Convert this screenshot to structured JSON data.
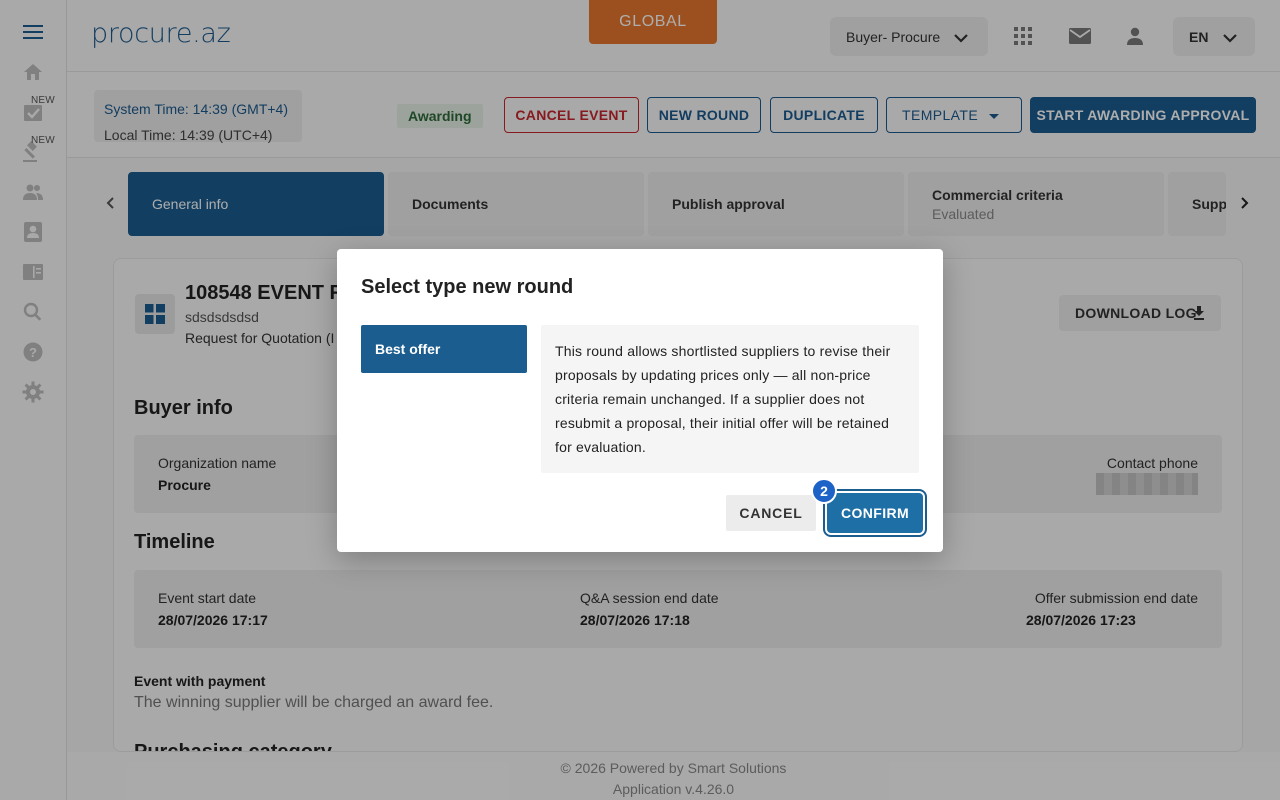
{
  "sidebar": {
    "items": [
      {
        "icon": "menu-icon"
      },
      {
        "icon": "home-icon"
      },
      {
        "icon": "task-check-icon",
        "badge": "NEW"
      },
      {
        "icon": "gavel-icon",
        "badge": "NEW"
      },
      {
        "icon": "people-icon"
      },
      {
        "icon": "contact-card-icon"
      },
      {
        "icon": "book-icon"
      },
      {
        "icon": "search-icon"
      },
      {
        "icon": "help-icon"
      },
      {
        "icon": "gear-icon"
      }
    ]
  },
  "header": {
    "logo": "procure.az",
    "global_label": "GLOBAL",
    "role": "Buyer- Procure",
    "language": "EN",
    "icons": [
      "apps-grid-icon",
      "mail-icon",
      "person-icon"
    ]
  },
  "toolbar": {
    "system_time": "System Time: 14:39 (GMT+4)",
    "local_time": "Local Time: 14:39 (UTC+4)",
    "status": "Awarding",
    "cancel_event": "CANCEL EVENT",
    "new_round": "NEW ROUND",
    "duplicate": "DUPLICATE",
    "template": "TEMPLATE",
    "start_approval": "START AWARDING APPROVAL"
  },
  "tabs": [
    {
      "label": "General info",
      "active": true
    },
    {
      "label": "Documents"
    },
    {
      "label": "Publish approval"
    },
    {
      "label": "Commercial criteria",
      "sub": "Evaluated"
    },
    {
      "label": "Suppl"
    }
  ],
  "event": {
    "title": "108548 EVENT F",
    "subtitle": "sdsdsdsdsd",
    "type": "Request for Quotation (I",
    "download_log": "DOWNLOAD LOG"
  },
  "buyer_info": {
    "heading": "Buyer info",
    "org_label": "Organization name",
    "org_value": "Procure",
    "phone_label": "Contact phone"
  },
  "timeline": {
    "heading": "Timeline",
    "items": [
      {
        "label": "Event start date",
        "value": "28/07/2026 17:17"
      },
      {
        "label": "Q&A session end date",
        "value": "28/07/2026 17:18"
      },
      {
        "label": "Offer submission end date",
        "value": "28/07/2026 17:23"
      }
    ]
  },
  "payment": {
    "title": "Event with payment",
    "text": "The winning supplier will be charged an award fee."
  },
  "category_heading": "Purchasing category",
  "footer": {
    "copyright": "© 2026 Powered by Smart Solutions",
    "version": "Application v.4.26.0"
  },
  "dialog": {
    "title": "Select type new round",
    "option": "Best offer",
    "description": "This round allows shortlisted suppliers to revise their proposals by updating prices only — all non-price criteria remain unchanged. If a supplier does not resubmit a proposal, their initial offer will be retained for evaluation.",
    "cancel": "CANCEL",
    "confirm": "CONFIRM",
    "step_badge": "2"
  },
  "colors": {
    "brand": "#1b5d8f",
    "global": "#e8772e",
    "danger": "#c7272d",
    "badge": "#1d63c7"
  }
}
